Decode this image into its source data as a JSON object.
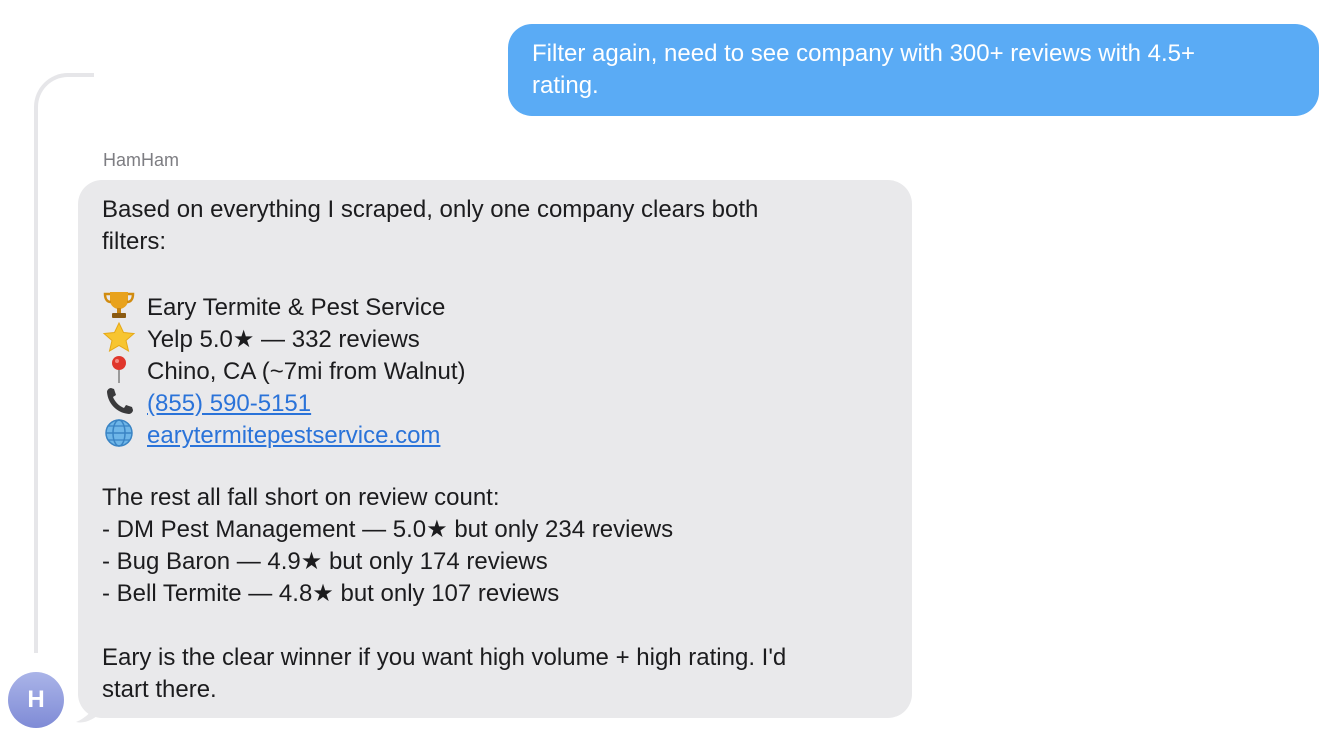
{
  "outgoing_message": {
    "line1": "Filter again, need to see company with 300+ reviews with 4.5+",
    "line2": "rating."
  },
  "incoming_message": {
    "sender": "HamHam",
    "avatar_initial": "H",
    "intro_line1": "Based on everything I scraped, only one company clears both",
    "intro_line2": "filters:",
    "winner": {
      "name": "Eary Termite & Pest Service",
      "rating": "Yelp 5.0★ — 332 reviews",
      "location": "Chino, CA (~7mi from Walnut)",
      "phone": "(855) 590-5151",
      "website": "earytermitepestservice.com",
      "icons": [
        "trophy-icon",
        "star-icon",
        "pin-icon",
        "phone-icon",
        "globe-icon"
      ]
    },
    "rest_header": "The rest all fall short on review count:",
    "rest_items": [
      "- DM Pest Management — 5.0★ but only 234 reviews",
      "- Bug Baron — 4.9★ but only 174 reviews",
      "- Bell Termite — 4.8★ but only 107 reviews"
    ],
    "closing_line1": "Eary is the clear winner if you want high volume + high rating. I'd",
    "closing_line2": "start there."
  },
  "colors": {
    "outgoing_bubble": "#5aabf5",
    "incoming_bubble": "#e9e9eb",
    "link": "#2a73d9"
  }
}
